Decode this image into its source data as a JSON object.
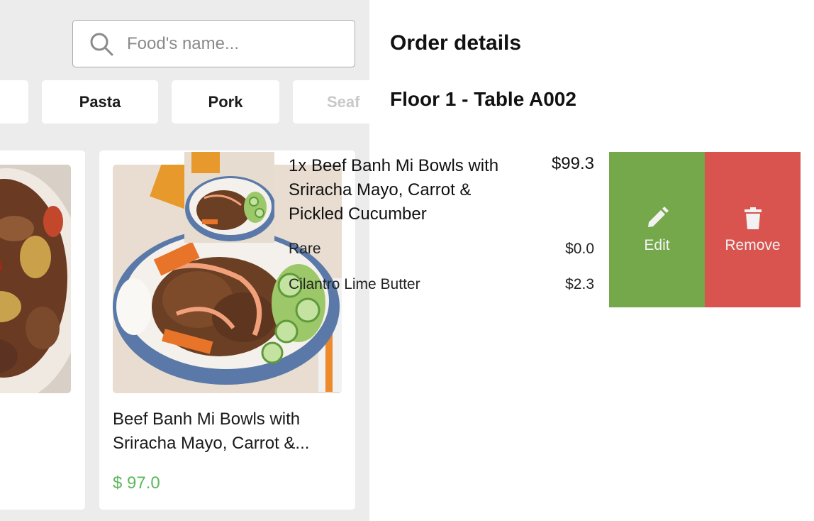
{
  "search": {
    "placeholder": "Food's name...",
    "value": ""
  },
  "categories": [
    {
      "label": ""
    },
    {
      "label": "Pasta"
    },
    {
      "label": "Pork"
    },
    {
      "label": "Seaf"
    }
  ],
  "menu_cards": [
    {
      "name": "",
      "price": ""
    },
    {
      "name": "Beef Banh Mi Bowls with Sriracha Mayo, Carrot &...",
      "price": "$ 97.0"
    }
  ],
  "order": {
    "title": "Order details",
    "table": "Floor 1 - Table A002",
    "item": {
      "name": "1x Beef Banh Mi Bowls with Sriracha Mayo, Carrot & Pickled Cucumber",
      "price": "$99.3",
      "options": [
        {
          "name": "Rare",
          "price": "$0.0"
        },
        {
          "name": "Cilantro Lime Butter",
          "price": "$2.3"
        }
      ]
    },
    "actions": {
      "edit": "Edit",
      "remove": "Remove"
    }
  },
  "colors": {
    "price_green": "#5cb85c",
    "edit_green": "#74a84a",
    "remove_red": "#d9534f",
    "left_bg": "#ececec"
  },
  "icons": [
    "search-icon",
    "pencil-icon",
    "trash-icon"
  ]
}
